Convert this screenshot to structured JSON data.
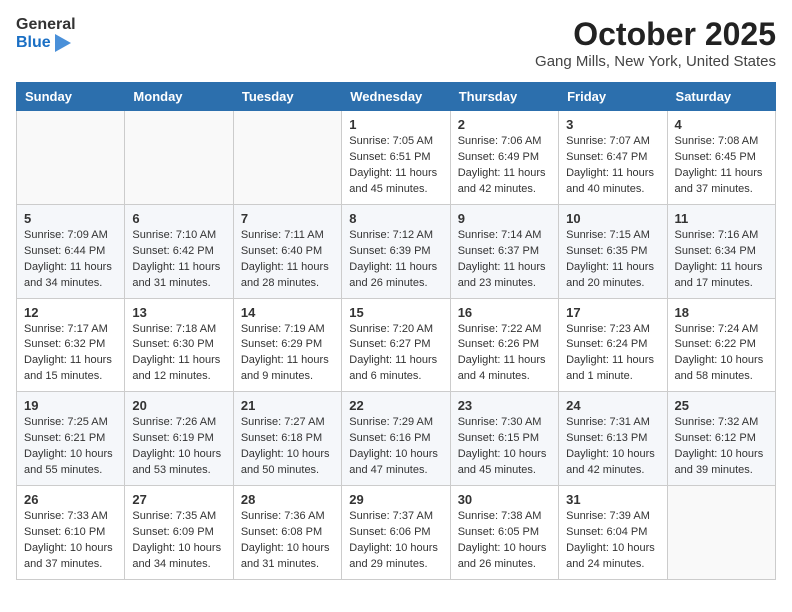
{
  "header": {
    "logo_general": "General",
    "logo_blue": "Blue",
    "month": "October 2025",
    "location": "Gang Mills, New York, United States"
  },
  "weekdays": [
    "Sunday",
    "Monday",
    "Tuesday",
    "Wednesday",
    "Thursday",
    "Friday",
    "Saturday"
  ],
  "weeks": [
    [
      {
        "day": "",
        "content": ""
      },
      {
        "day": "",
        "content": ""
      },
      {
        "day": "",
        "content": ""
      },
      {
        "day": "1",
        "content": "Sunrise: 7:05 AM\nSunset: 6:51 PM\nDaylight: 11 hours\nand 45 minutes."
      },
      {
        "day": "2",
        "content": "Sunrise: 7:06 AM\nSunset: 6:49 PM\nDaylight: 11 hours\nand 42 minutes."
      },
      {
        "day": "3",
        "content": "Sunrise: 7:07 AM\nSunset: 6:47 PM\nDaylight: 11 hours\nand 40 minutes."
      },
      {
        "day": "4",
        "content": "Sunrise: 7:08 AM\nSunset: 6:45 PM\nDaylight: 11 hours\nand 37 minutes."
      }
    ],
    [
      {
        "day": "5",
        "content": "Sunrise: 7:09 AM\nSunset: 6:44 PM\nDaylight: 11 hours\nand 34 minutes."
      },
      {
        "day": "6",
        "content": "Sunrise: 7:10 AM\nSunset: 6:42 PM\nDaylight: 11 hours\nand 31 minutes."
      },
      {
        "day": "7",
        "content": "Sunrise: 7:11 AM\nSunset: 6:40 PM\nDaylight: 11 hours\nand 28 minutes."
      },
      {
        "day": "8",
        "content": "Sunrise: 7:12 AM\nSunset: 6:39 PM\nDaylight: 11 hours\nand 26 minutes."
      },
      {
        "day": "9",
        "content": "Sunrise: 7:14 AM\nSunset: 6:37 PM\nDaylight: 11 hours\nand 23 minutes."
      },
      {
        "day": "10",
        "content": "Sunrise: 7:15 AM\nSunset: 6:35 PM\nDaylight: 11 hours\nand 20 minutes."
      },
      {
        "day": "11",
        "content": "Sunrise: 7:16 AM\nSunset: 6:34 PM\nDaylight: 11 hours\nand 17 minutes."
      }
    ],
    [
      {
        "day": "12",
        "content": "Sunrise: 7:17 AM\nSunset: 6:32 PM\nDaylight: 11 hours\nand 15 minutes."
      },
      {
        "day": "13",
        "content": "Sunrise: 7:18 AM\nSunset: 6:30 PM\nDaylight: 11 hours\nand 12 minutes."
      },
      {
        "day": "14",
        "content": "Sunrise: 7:19 AM\nSunset: 6:29 PM\nDaylight: 11 hours\nand 9 minutes."
      },
      {
        "day": "15",
        "content": "Sunrise: 7:20 AM\nSunset: 6:27 PM\nDaylight: 11 hours\nand 6 minutes."
      },
      {
        "day": "16",
        "content": "Sunrise: 7:22 AM\nSunset: 6:26 PM\nDaylight: 11 hours\nand 4 minutes."
      },
      {
        "day": "17",
        "content": "Sunrise: 7:23 AM\nSunset: 6:24 PM\nDaylight: 11 hours\nand 1 minute."
      },
      {
        "day": "18",
        "content": "Sunrise: 7:24 AM\nSunset: 6:22 PM\nDaylight: 10 hours\nand 58 minutes."
      }
    ],
    [
      {
        "day": "19",
        "content": "Sunrise: 7:25 AM\nSunset: 6:21 PM\nDaylight: 10 hours\nand 55 minutes."
      },
      {
        "day": "20",
        "content": "Sunrise: 7:26 AM\nSunset: 6:19 PM\nDaylight: 10 hours\nand 53 minutes."
      },
      {
        "day": "21",
        "content": "Sunrise: 7:27 AM\nSunset: 6:18 PM\nDaylight: 10 hours\nand 50 minutes."
      },
      {
        "day": "22",
        "content": "Sunrise: 7:29 AM\nSunset: 6:16 PM\nDaylight: 10 hours\nand 47 minutes."
      },
      {
        "day": "23",
        "content": "Sunrise: 7:30 AM\nSunset: 6:15 PM\nDaylight: 10 hours\nand 45 minutes."
      },
      {
        "day": "24",
        "content": "Sunrise: 7:31 AM\nSunset: 6:13 PM\nDaylight: 10 hours\nand 42 minutes."
      },
      {
        "day": "25",
        "content": "Sunrise: 7:32 AM\nSunset: 6:12 PM\nDaylight: 10 hours\nand 39 minutes."
      }
    ],
    [
      {
        "day": "26",
        "content": "Sunrise: 7:33 AM\nSunset: 6:10 PM\nDaylight: 10 hours\nand 37 minutes."
      },
      {
        "day": "27",
        "content": "Sunrise: 7:35 AM\nSunset: 6:09 PM\nDaylight: 10 hours\nand 34 minutes."
      },
      {
        "day": "28",
        "content": "Sunrise: 7:36 AM\nSunset: 6:08 PM\nDaylight: 10 hours\nand 31 minutes."
      },
      {
        "day": "29",
        "content": "Sunrise: 7:37 AM\nSunset: 6:06 PM\nDaylight: 10 hours\nand 29 minutes."
      },
      {
        "day": "30",
        "content": "Sunrise: 7:38 AM\nSunset: 6:05 PM\nDaylight: 10 hours\nand 26 minutes."
      },
      {
        "day": "31",
        "content": "Sunrise: 7:39 AM\nSunset: 6:04 PM\nDaylight: 10 hours\nand 24 minutes."
      },
      {
        "day": "",
        "content": ""
      }
    ]
  ]
}
